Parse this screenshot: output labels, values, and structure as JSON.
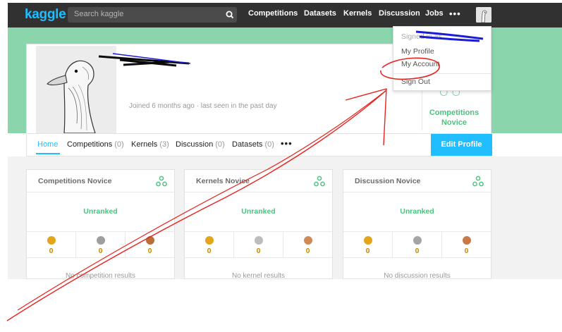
{
  "nav": {
    "logo": "kaggle",
    "search_placeholder": "Search kaggle",
    "links": [
      "Competitions",
      "Datasets",
      "Kernels",
      "Discussion",
      "Jobs"
    ],
    "more": "•••"
  },
  "profile": {
    "joined": "Joined 6 months ago · last seen in the past day",
    "tier": "Competitions Novice"
  },
  "tabs": {
    "home": "Home",
    "competitions": "Competitions",
    "competitions_count": "(0)",
    "kernels": "Kernels",
    "kernels_count": "(3)",
    "discussion": "Discussion",
    "discussion_count": "(0)",
    "datasets": "Datasets",
    "datasets_count": "(0)",
    "more": "•••",
    "edit_profile": "Edit Profile"
  },
  "cards": [
    {
      "title": "Competitions Novice",
      "rank": "Unranked",
      "medals": [
        "0",
        "0",
        "0"
      ],
      "footer": "No competition results"
    },
    {
      "title": "Kernels Novice",
      "rank": "Unranked",
      "medals": [
        "0",
        "0",
        "0"
      ],
      "footer": "No kernel results"
    },
    {
      "title": "Discussion Novice",
      "rank": "Unranked",
      "medals": [
        "0",
        "0",
        "0"
      ],
      "footer": "No discussion results"
    }
  ],
  "dropdown": {
    "signed_in_as": "Signed in as",
    "my_profile": "My Profile",
    "my_account": "My Account",
    "sign_out": "Sign Out"
  },
  "colors": {
    "brand": "#20beff",
    "hero": "#8ad5ac",
    "novice": "#4ec27f",
    "annotation": "#e8231f"
  }
}
